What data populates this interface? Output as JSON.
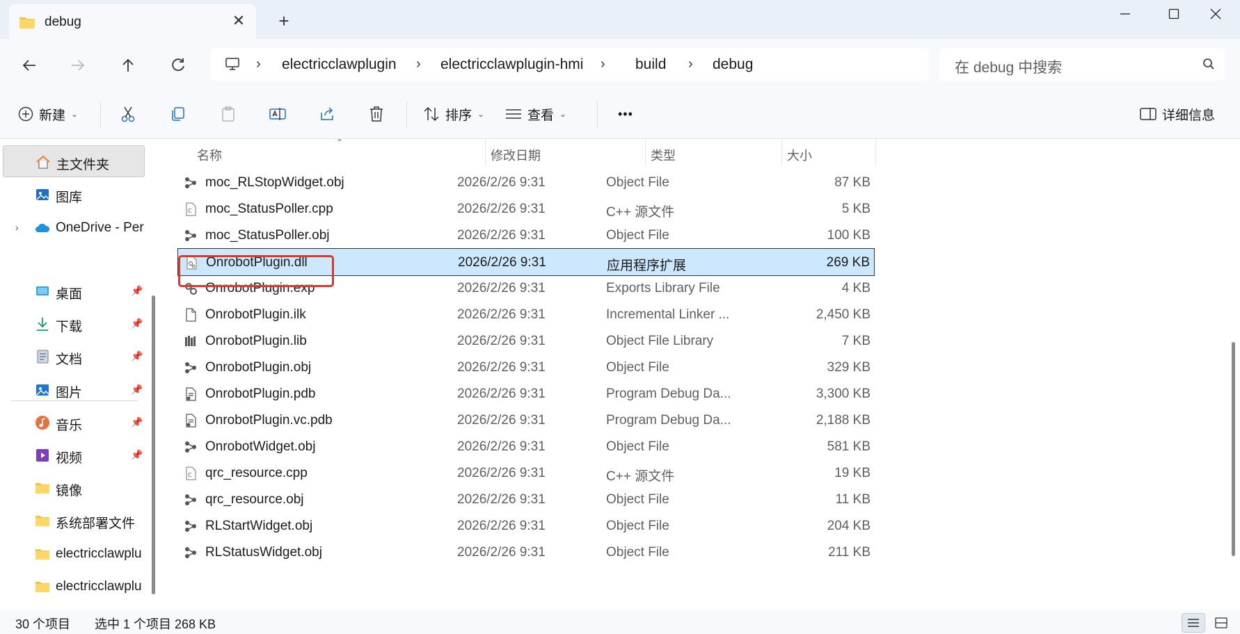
{
  "tab": {
    "title": "debug",
    "close": "✕",
    "new_tab": "+"
  },
  "window": {
    "minimize": "—",
    "maximize": "☐",
    "close": "✕"
  },
  "breadcrumb": [
    "electricclawplugin",
    "electricclawplugin-hmi",
    "build",
    "debug"
  ],
  "search": {
    "placeholder": "在 debug 中搜索"
  },
  "toolbar": {
    "new_label": "新建",
    "sort_label": "排序",
    "view_label": "查看",
    "more_label": "•••",
    "details_label": "详细信息"
  },
  "sidebar": {
    "items": [
      {
        "label": "主文件夹",
        "icon": "home-icon"
      },
      {
        "label": "图库",
        "icon": "gallery-icon"
      },
      {
        "label": "OneDrive - Per",
        "icon": "cloud-icon"
      },
      {
        "label": "桌面",
        "icon": "desktop-icon"
      },
      {
        "label": "下载",
        "icon": "download-icon"
      },
      {
        "label": "文档",
        "icon": "document-icon"
      },
      {
        "label": "图片",
        "icon": "pictures-icon"
      },
      {
        "label": "音乐",
        "icon": "music-icon"
      },
      {
        "label": "视频",
        "icon": "video-icon"
      },
      {
        "label": "镜像",
        "icon": "folder-icon"
      },
      {
        "label": "系统部署文件",
        "icon": "folder-icon"
      },
      {
        "label": "electricclawplu",
        "icon": "folder-icon"
      },
      {
        "label": "electricclawplu",
        "icon": "folder-icon"
      }
    ]
  },
  "columns": {
    "name": "名称",
    "date": "修改日期",
    "type": "类型",
    "size": "大小"
  },
  "files": [
    {
      "name": "moc_RLStopWidget.obj",
      "date": "2026/2/26 9:31",
      "type": "Object File",
      "size": "87 KB",
      "icon": "obj-icon"
    },
    {
      "name": "moc_StatusPoller.cpp",
      "date": "2026/2/26 9:31",
      "type": "C++ 源文件",
      "size": "5 KB",
      "icon": "cpp-icon"
    },
    {
      "name": "moc_StatusPoller.obj",
      "date": "2026/2/26 9:31",
      "type": "Object File",
      "size": "100 KB",
      "icon": "obj-icon"
    },
    {
      "name": "OnrobotPlugin.dll",
      "date": "2026/2/26 9:31",
      "type": "应用程序扩展",
      "size": "269 KB",
      "icon": "dll-icon",
      "selected": true
    },
    {
      "name": "OnrobotPlugin.exp",
      "date": "2026/2/26 9:31",
      "type": "Exports Library File",
      "size": "4 KB",
      "icon": "exp-icon"
    },
    {
      "name": "OnrobotPlugin.ilk",
      "date": "2026/2/26 9:31",
      "type": "Incremental Linker ...",
      "size": "2,450 KB",
      "icon": "ilk-icon"
    },
    {
      "name": "OnrobotPlugin.lib",
      "date": "2026/2/26 9:31",
      "type": "Object File Library",
      "size": "7 KB",
      "icon": "lib-icon"
    },
    {
      "name": "OnrobotPlugin.obj",
      "date": "2026/2/26 9:31",
      "type": "Object File",
      "size": "329 KB",
      "icon": "obj-icon"
    },
    {
      "name": "OnrobotPlugin.pdb",
      "date": "2026/2/26 9:31",
      "type": "Program Debug Da...",
      "size": "3,300 KB",
      "icon": "pdb-icon"
    },
    {
      "name": "OnrobotPlugin.vc.pdb",
      "date": "2026/2/26 9:31",
      "type": "Program Debug Da...",
      "size": "2,188 KB",
      "icon": "pdb-icon"
    },
    {
      "name": "OnrobotWidget.obj",
      "date": "2026/2/26 9:31",
      "type": "Object File",
      "size": "581 KB",
      "icon": "obj-icon"
    },
    {
      "name": "qrc_resource.cpp",
      "date": "2026/2/26 9:31",
      "type": "C++ 源文件",
      "size": "19 KB",
      "icon": "cpp-icon"
    },
    {
      "name": "qrc_resource.obj",
      "date": "2026/2/26 9:31",
      "type": "Object File",
      "size": "11 KB",
      "icon": "obj-icon"
    },
    {
      "name": "RLStartWidget.obj",
      "date": "2026/2/26 9:31",
      "type": "Object File",
      "size": "204 KB",
      "icon": "obj-icon"
    },
    {
      "name": "RLStatusWidget.obj",
      "date": "2026/2/26 9:31",
      "type": "Object File",
      "size": "211 KB",
      "icon": "obj-icon"
    }
  ],
  "status": {
    "count": "30 个项目",
    "selection": "选中 1 个项目  268 KB"
  },
  "colors": {
    "selection_bg": "#cce8ff",
    "highlight": "#d93a2b",
    "chrome": "#f7f9fc"
  }
}
